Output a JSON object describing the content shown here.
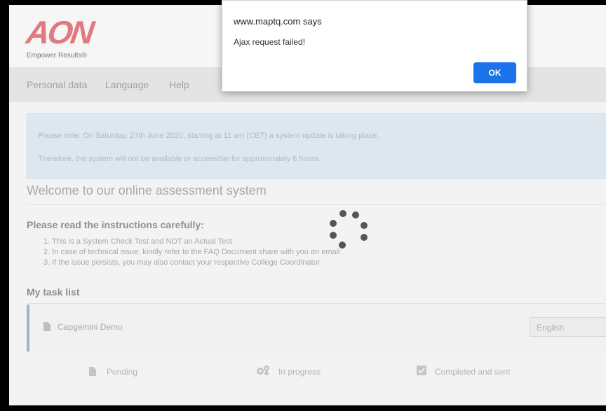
{
  "brand": {
    "logo_text": "AON",
    "tagline": "Empower Results®",
    "logo_color": "#e07a80"
  },
  "nav": {
    "items": [
      {
        "label": "Personal data"
      },
      {
        "label": "Language"
      },
      {
        "label": "Help"
      }
    ]
  },
  "notice": {
    "line1": "Please note: On Saturday, 27th June 2020, starting at 11 am (CET) a system update is taking place.",
    "line2": "Therefore, the system will not be available or accessible for approximately 6 hours."
  },
  "welcome": {
    "title": "Welcome to our online assessment system"
  },
  "instructions": {
    "title": "Please read the instructions carefully:",
    "items": [
      "1. This is a System Check Test and NOT an Actual Test",
      "2. In case of technical issue, kindly refer to the FAQ Document share with you on email",
      "3. If the issue persists, you may also contact your respective College Coordinator"
    ]
  },
  "tasks": {
    "title": "My task list",
    "items": [
      {
        "name": "Capgemini Demo",
        "icon": "document-icon",
        "language": "English"
      }
    ]
  },
  "legend": {
    "pending": {
      "label": "Pending",
      "icon": "document-icon"
    },
    "in_progress": {
      "label": "In progress",
      "icon": "gears-icon"
    },
    "completed": {
      "label": "Completed and sent",
      "icon": "checkbox-icon"
    }
  },
  "dialog": {
    "title": "www.maptq.com says",
    "message": "Ajax request failed!",
    "ok_label": "OK",
    "accent": "#1a73e8"
  },
  "loading": {
    "icon": "loading-spinner-icon"
  }
}
